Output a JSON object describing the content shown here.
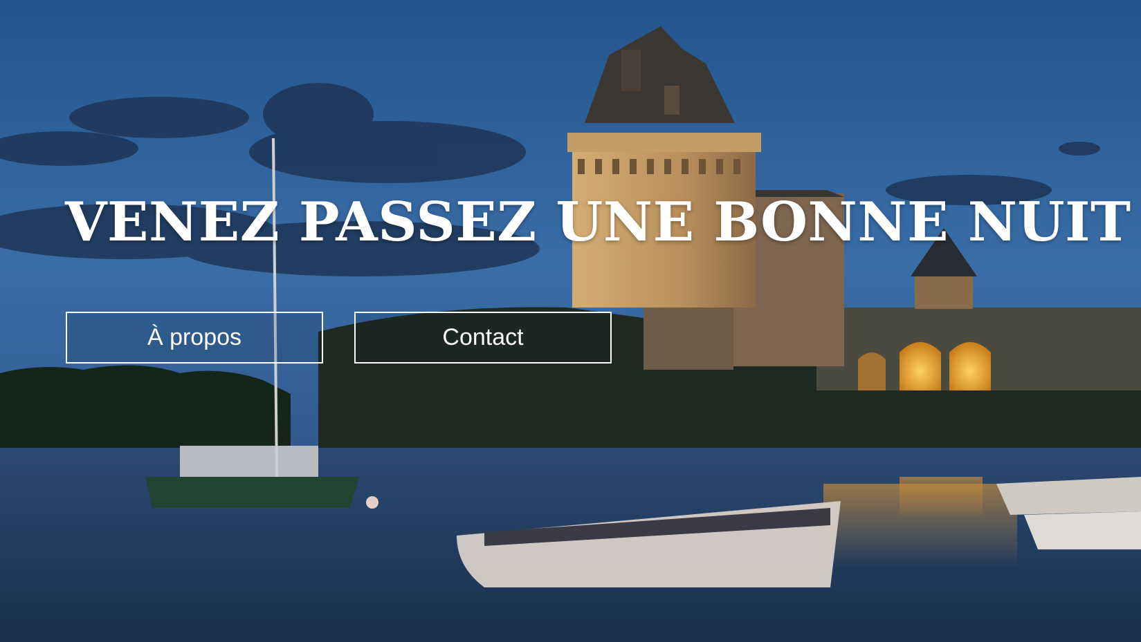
{
  "hero": {
    "title": "VENEZ PASSEZ UNE BONNE NUIT",
    "buttons": {
      "about": "À propos",
      "contact": "Contact"
    }
  },
  "colors": {
    "text": "#ffffff",
    "sky_top": "#2d5f98",
    "sky_bottom": "#3d6fa6",
    "water": "#243f63",
    "tower_light": "#c9a26a",
    "arch_glow": "#f2a52e"
  }
}
